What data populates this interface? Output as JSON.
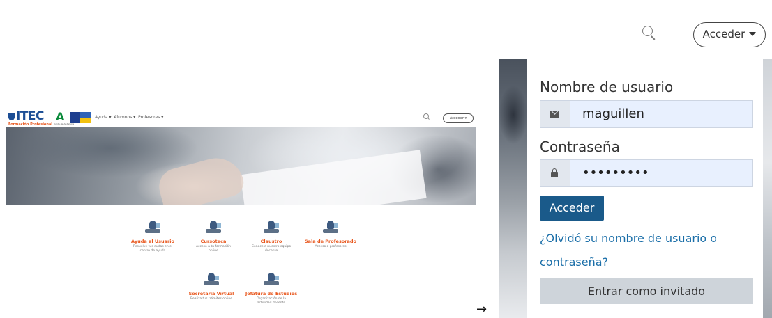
{
  "thumbnail": {
    "logo": "ITEC",
    "logo_sub": "Formación Profesional",
    "brand_letter": "A",
    "brand_letter_sub": "Junta de Andalucía",
    "nav_items": [
      "Ayuda ▾",
      "Alumnos ▾",
      "Profesores ▾"
    ],
    "access_label": "Acceder ▾",
    "cards": [
      {
        "title": "Ayuda al Usuario",
        "desc": "Resuelve tus dudas en el centro de ayuda"
      },
      {
        "title": "Cursoteca",
        "desc": "Acceso a tu formación online"
      },
      {
        "title": "Claustro",
        "desc": "Conoce a nuestro equipo docente"
      },
      {
        "title": "Sala de Profesorado",
        "desc": "Acceso a profesores"
      },
      {
        "title": "Secretaría Virtual",
        "desc": "Realiza tus trámites online"
      },
      {
        "title": "Jefatura de Estudios",
        "desc": "Organización de la actividad docente"
      }
    ]
  },
  "arrow": "→",
  "header": {
    "search_icon": "search-icon",
    "access_label": "Acceder"
  },
  "login": {
    "username_label": "Nombre de usuario",
    "username_value": "maguillen",
    "password_label": "Contraseña",
    "password_value": "•••••••••",
    "submit_label": "Acceder",
    "forgot_line1": "¿Olvidó su nombre de usuario o",
    "forgot_line2": "contraseña?",
    "guest_label": "Entrar como invitado"
  },
  "colors": {
    "primary": "#1a5a8a",
    "link": "#1a6ea8",
    "accent": "#e8561c",
    "input_bg": "#e8f0fe"
  }
}
